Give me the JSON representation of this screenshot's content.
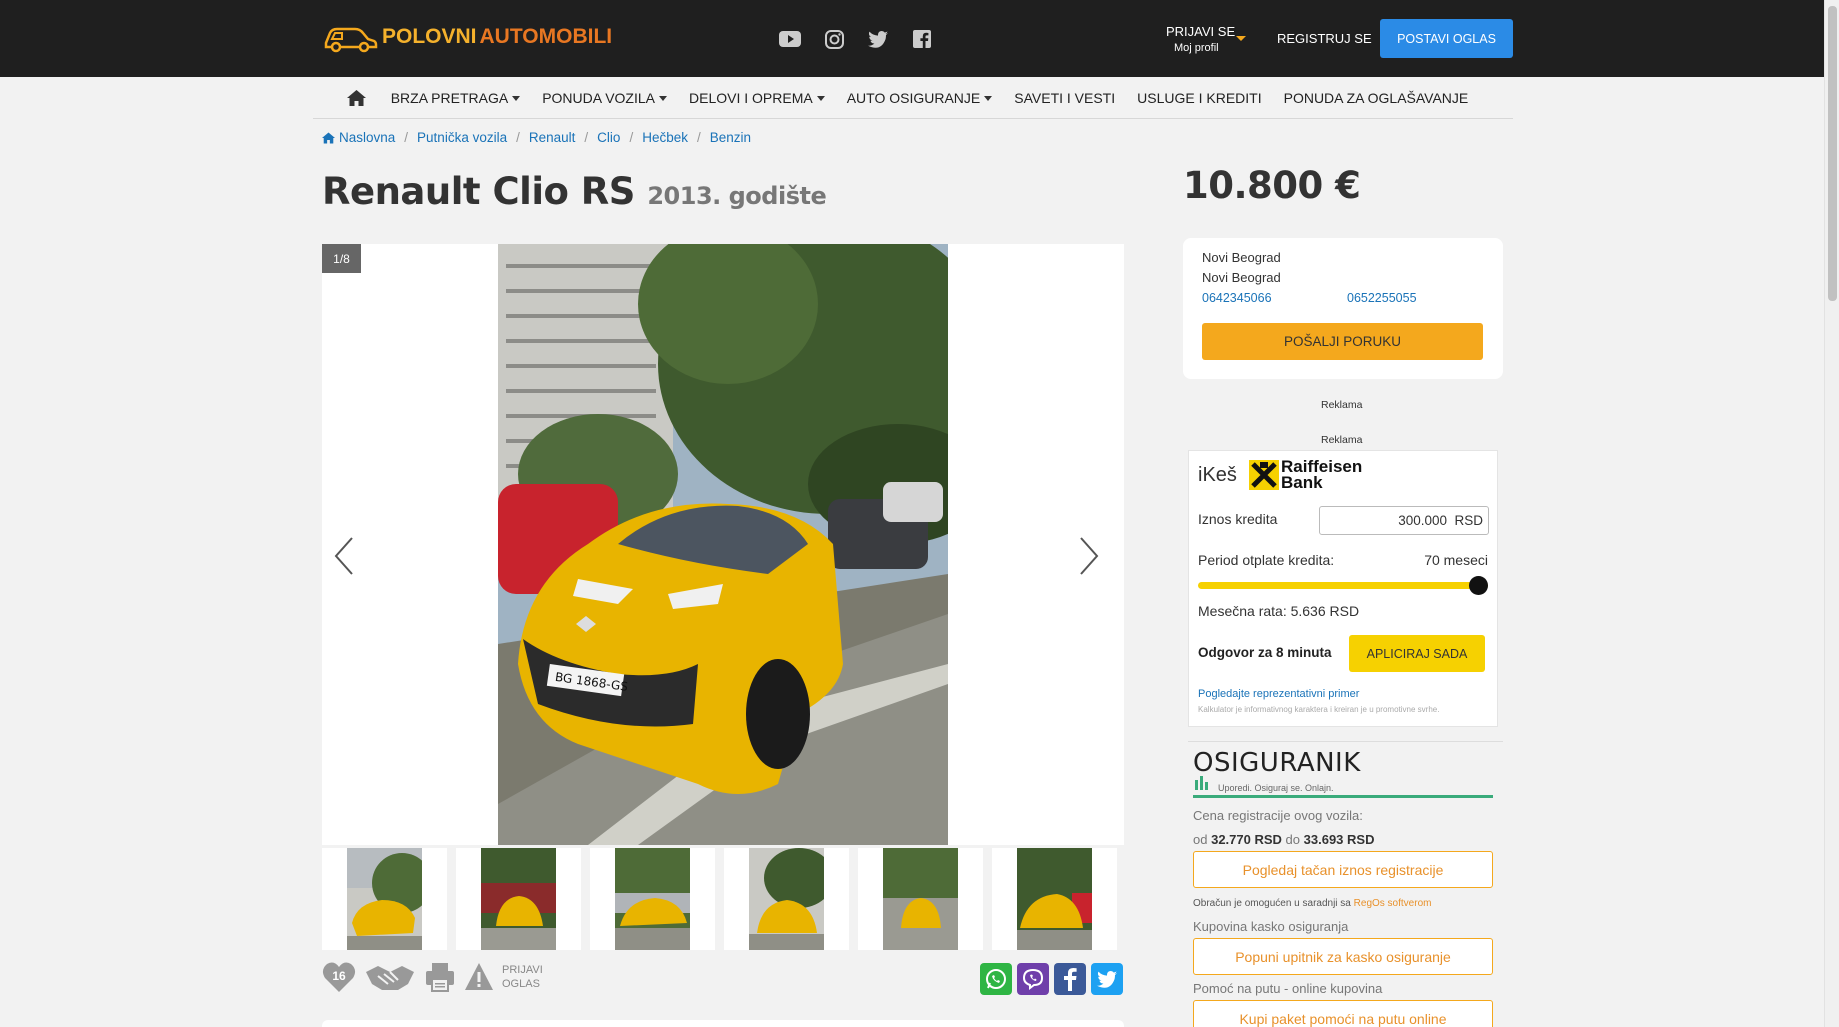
{
  "header": {
    "logo_word1": "POLOVNI",
    "logo_word2": "AUTOMOBILI",
    "social_icons": [
      "youtube-icon",
      "instagram-icon",
      "twitter-icon",
      "facebook-icon"
    ],
    "login_label": "PRIJAVI SE",
    "profile_label": "Moj profil",
    "register_label": "REGISTRUJ SE",
    "post_ad_label": "POSTAVI OGLAS"
  },
  "nav": {
    "items": [
      {
        "label": "BRZA PRETRAGA",
        "dropdown": true
      },
      {
        "label": "PONUDA VOZILA",
        "dropdown": true
      },
      {
        "label": "DELOVI I OPREMA",
        "dropdown": true
      },
      {
        "label": "AUTO OSIGURANJE",
        "dropdown": true
      },
      {
        "label": "SAVETI I VESTI",
        "dropdown": false
      },
      {
        "label": "USLUGE I KREDITI",
        "dropdown": false
      },
      {
        "label": "PONUDA ZA OGLAŠAVANJE",
        "dropdown": false
      }
    ]
  },
  "breadcrumb": [
    "Naslovna",
    "Putnička vozila",
    "Renault",
    "Clio",
    "Hečbek",
    "Benzin"
  ],
  "listing": {
    "title": "Renault Clio RS",
    "year": "2013. godište",
    "price": "10.800 €",
    "photo_counter": "1/8",
    "favorites_count": "16",
    "report_label_1": "PRIJAVI",
    "report_label_2": "OGLAS"
  },
  "seller": {
    "location_1": "Novi Beograd",
    "location_2": "Novi Beograd",
    "phone_1": "0642345066",
    "phone_2": "0652255055",
    "message_button": "POŠALJI PORUKU"
  },
  "ads": {
    "label_1": "Reklama",
    "label_2": "Reklama"
  },
  "loan": {
    "product": "iKeš",
    "bank_line1": "Raiffeisen",
    "bank_line2": "Bank",
    "amount_label": "Iznos kredita",
    "amount_value": "300.000  RSD",
    "period_label": "Period otplate kredita:",
    "period_value": "70 meseci",
    "period_fraction": 1.0,
    "monthly_label": "Mesečna rata: 5.636 RSD",
    "response_label": "Odgovor za 8 minuta",
    "apply_button": "APLICIRAJ SADA",
    "example_link": "Pogledajte reprezentativni primer",
    "disclaimer": "Kalkulator je informativnog karaktera i kreiran je u promotivne svrhe."
  },
  "insurance": {
    "brand": "OSIGURANIK",
    "tagline": "Uporedi. Osiguraj se. Onlajn.",
    "reg_label": "Cena registracije ovog vozila:",
    "reg_from_word": "od",
    "reg_from": "32.770 RSD",
    "reg_to_word": "do",
    "reg_to": "33.693 RSD",
    "reg_button": "Pogledaj tačan iznos registracije",
    "cooperation_text": "Obračun je omogućen u saradnji sa",
    "cooperation_link": "RegOs softverom",
    "kasko_label": "Kupovina kasko osiguranja",
    "kasko_button": "Popuni upitnik za kasko osiguranje",
    "roadside_label": "Pomoć na putu - online kupovina",
    "roadside_button": "Kupi paket pomoći na putu online"
  },
  "colors": {
    "header_bg": "#1f1f1f",
    "accent_orange": "#f4a81d",
    "post_button": "#2b8be6",
    "link_blue": "#1a73b8",
    "loan_yellow": "#f6d101",
    "car_yellow": "#e8b400",
    "insurance_green": "#3aab7b"
  }
}
